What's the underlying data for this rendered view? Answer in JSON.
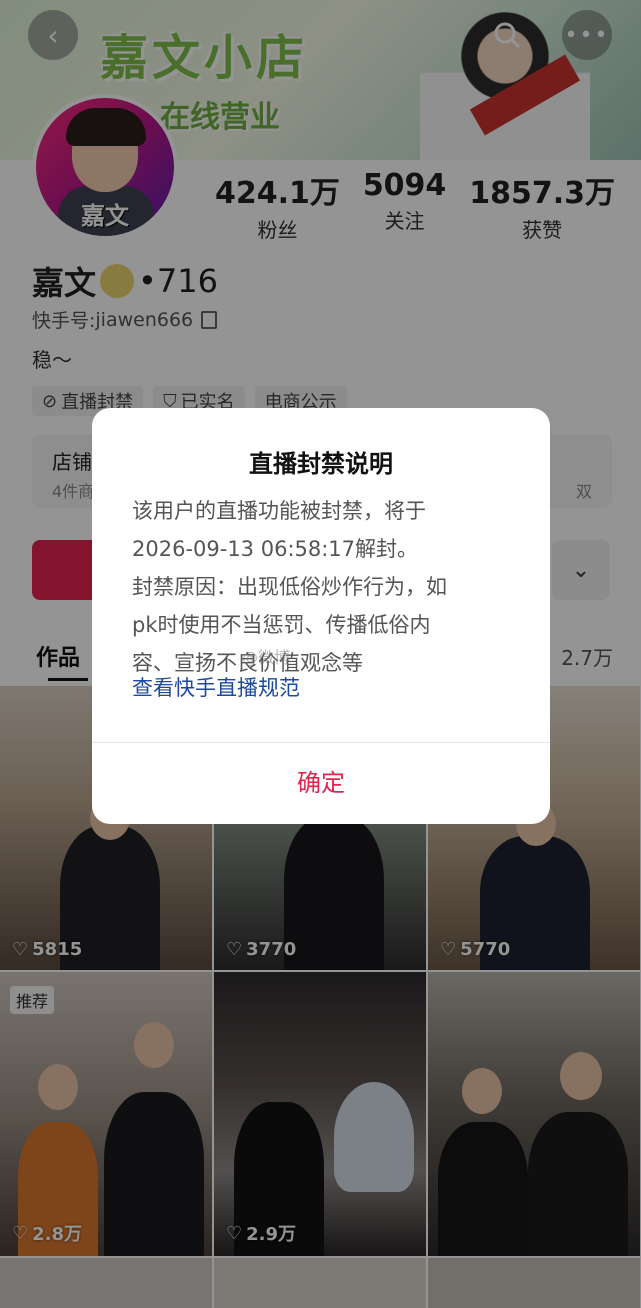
{
  "colors": {
    "accent": "#e3244f",
    "link": "#1c4a9c"
  },
  "header": {
    "back_icon": "back-icon",
    "search_icon": "search-icon",
    "more_icon": "more-icon",
    "banner_line1": "嘉文小店",
    "banner_line2": "在线营业"
  },
  "profile": {
    "avatar_name": "嘉文",
    "name": "嘉文",
    "level": "•716",
    "uid_label": "快手号:",
    "uid": "jiawen666",
    "bio": "稳～",
    "stats": [
      {
        "value": "424.1万",
        "label": "粉丝"
      },
      {
        "value": "5094",
        "label": "关注"
      },
      {
        "value": "1857.3万",
        "label": "获赞"
      }
    ],
    "tags": [
      "直播封禁",
      "已实名",
      "电商公示"
    ]
  },
  "shop": {
    "title": "店铺",
    "subtitle": "4件商",
    "right": "双"
  },
  "tabs": {
    "works": "作品",
    "likes_count": "2.7万"
  },
  "grid": [
    {
      "likes": "5815",
      "badge": ""
    },
    {
      "likes": "3770",
      "badge": ""
    },
    {
      "likes": "5770",
      "badge": ""
    },
    {
      "likes": "2.8万",
      "badge": "推荐"
    },
    {
      "likes": "2.9万",
      "badge": ""
    },
    {
      "likes": "",
      "badge": ""
    }
  ],
  "dialog": {
    "title": "直播封禁说明",
    "line1": "该用户的直播功能被封禁，将于",
    "line2": "2026-09-13 06:58:17解封。",
    "line3": "封禁原因：出现低俗炒作行为，如",
    "line4": "pk时使用不当惩罚、传播低俗内",
    "line5": "容、宣扬不良价值观念等",
    "link": "查看快手直播规范",
    "ok": "确定",
    "watermark": "@微博"
  }
}
